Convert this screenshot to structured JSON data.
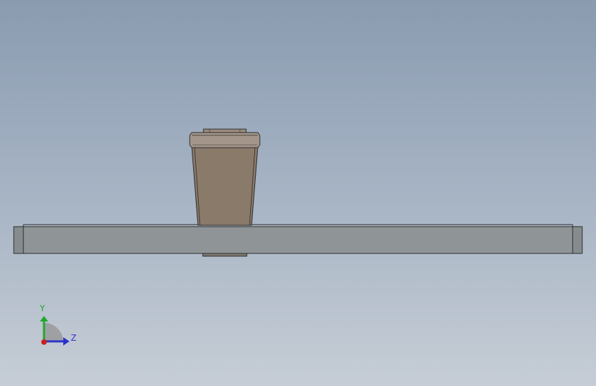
{
  "viewport": {
    "background_top": "#8a9bb0",
    "background_bottom": "#c6cdd6"
  },
  "model": {
    "plate_color": "#8f9597",
    "handle_color": "#8a7a6a",
    "edge_color": "#2a2a2a"
  },
  "triad": {
    "y_label": "Y",
    "z_label": "Z",
    "y_color": "#1fa82a",
    "z_color": "#2b33c9",
    "x_color": "#cc1f1f"
  }
}
